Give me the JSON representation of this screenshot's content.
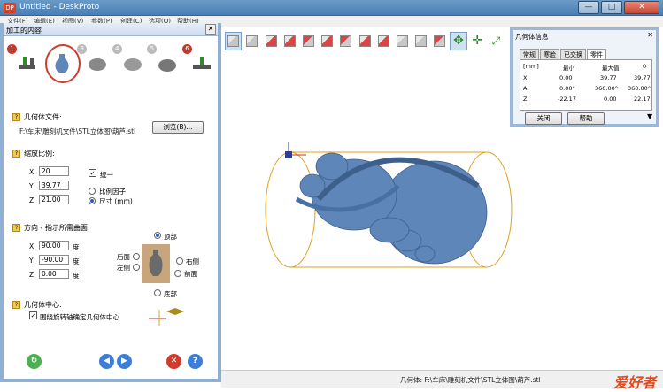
{
  "window": {
    "app_icon": "DP",
    "title": "Untitled - DeskProto",
    "min": "—",
    "max": "□",
    "close": "✕"
  },
  "menu": [
    "文件(F)",
    "编辑(E)",
    "视图(V)",
    "参数(P)",
    "创建(C)",
    "选项(O)",
    "帮助(H)"
  ],
  "panel": {
    "title": "加工的内容",
    "close": "✕",
    "steps": [
      "1",
      "2",
      "3",
      "4",
      "5",
      "6"
    ],
    "geometry_file_label": "几何体文件:",
    "geometry_file_path": "F:\\车床\\雕刻机文件\\STL立体图\\葫芦.stl",
    "browse_button": "浏览(B)...",
    "scale_label": "缩放比例:",
    "scale": {
      "x_label": "X",
      "x": "20",
      "y_label": "Y",
      "y": "39.77",
      "z_label": "Z",
      "z": "21.00"
    },
    "uniform_label": "统一",
    "uniform_check": "✓",
    "ratio_label": "比例因子",
    "size_label": "尺寸 (mm)",
    "orientation_label": "方向 - 指示所需曲面:",
    "rot": {
      "x_label": "X",
      "x": "90.00",
      "y_label": "Y",
      "y": "-90.00",
      "z_label": "Z",
      "z": "0.00",
      "unit": "度"
    },
    "faces": {
      "top": "顶部",
      "back": "后面",
      "right": "右侧",
      "left": "左侧",
      "front": "前面",
      "bottom": "底部"
    },
    "center_label": "几何体中心:",
    "center_check_label": "围绕旋转轴确定几何体中心",
    "center_check": "✓"
  },
  "dialog": {
    "title": "几何体信息",
    "close": "✕",
    "tabs": [
      "常规",
      "寒脸",
      "已交换",
      "零件"
    ],
    "headers": [
      "[mm]",
      "最小",
      "最大值",
      "0"
    ],
    "rows": [
      {
        "axis": "X",
        "min": "0.00",
        "max": "39.77",
        "size": "39.77"
      },
      {
        "axis": "A",
        "min": "0.00°",
        "max": "360.00°",
        "size": "360.00°"
      },
      {
        "axis": "Z",
        "min": "-22.17",
        "max": "0.00",
        "size": "22.17"
      }
    ],
    "close_button": "关闭",
    "help_button": "帮助"
  },
  "status": {
    "text": "几何体: F:\\车床\\雕刻机文件\\STL立体图\\葫芦.stl",
    "brand": "爱好者"
  },
  "colors": {
    "model": "#5f86b8",
    "cylinder": "#e0a020",
    "accent": "#d03a2b"
  }
}
